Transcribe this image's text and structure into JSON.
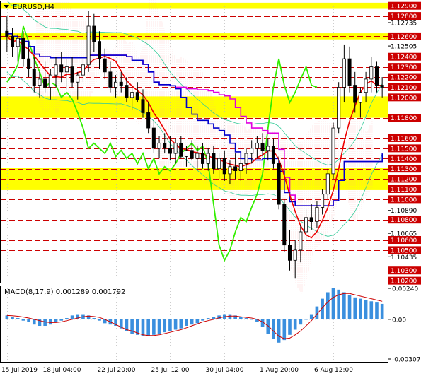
{
  "chart_data": [
    {
      "type": "candlestick",
      "title": "EURUSD,H4",
      "x_ticks": [
        "15 Jul 2019",
        "18 Jul 04:00",
        "22 Jul 20:00",
        "25 Jul 12:00",
        "30 Jul 04:00",
        "1 Aug 20:00",
        "6 Aug 12:00"
      ],
      "ylim": [
        1.1018,
        1.1295
      ],
      "y_ticks": [
        1.129,
        1.128,
        1.12735,
        1.126,
        1.12505,
        1.124,
        1.123,
        1.122,
        1.121,
        1.12,
        1.118,
        1.116,
        1.115,
        1.114,
        1.113,
        1.112,
        1.111,
        1.11,
        1.1089,
        1.108,
        1.10665,
        1.106,
        1.105,
        1.10435,
        1.103,
        1.102
      ],
      "y_tick_labels": [
        "1.12900",
        "1.12800",
        "1.12735",
        "1.12600",
        "1.12505",
        "1.12400",
        "1.12300",
        "1.12200",
        "1.12100",
        "1.12000",
        "1.11800",
        "1.11600",
        "1.11500",
        "1.11400",
        "1.11300",
        "1.11200",
        "1.11100",
        "1.11000",
        "1.10890",
        "1.10800",
        "1.10665",
        "1.10600",
        "1.10500",
        "1.10435",
        "1.10300",
        "1.10200"
      ],
      "highlighted_labels": [
        "1.12900",
        "1.12800",
        "1.12600",
        "1.12400",
        "1.12300",
        "1.12200",
        "1.12100",
        "1.12000",
        "1.11800",
        "1.11600",
        "1.11500",
        "1.11400",
        "1.11300",
        "1.11200",
        "1.11100",
        "1.11000",
        "1.10800",
        "1.10600",
        "1.10500",
        "1.10300",
        "1.10200"
      ],
      "resistance_support_levels": [
        1.129,
        1.128,
        1.126,
        1.124,
        1.123,
        1.122,
        1.121,
        1.12,
        1.118,
        1.116,
        1.115,
        1.114,
        1.113,
        1.112,
        1.111,
        1.11,
        1.108,
        1.106,
        1.105,
        1.103,
        1.102
      ],
      "yellow_zones": [
        [
          1.1287,
          1.1293
        ],
        [
          1.1257,
          1.1263
        ],
        [
          1.118,
          1.1201
        ],
        [
          1.1109,
          1.1131
        ]
      ],
      "candles_ohlc": [
        [
          1.1265,
          1.128,
          1.1245,
          1.126
        ],
        [
          1.126,
          1.1268,
          1.124,
          1.125
        ],
        [
          1.125,
          1.1262,
          1.1235,
          1.1258
        ],
        [
          1.1258,
          1.1265,
          1.123,
          1.1238
        ],
        [
          1.1238,
          1.125,
          1.122,
          1.1228
        ],
        [
          1.1228,
          1.124,
          1.1205,
          1.1212
        ],
        [
          1.1212,
          1.1225,
          1.12,
          1.1218
        ],
        [
          1.1218,
          1.1235,
          1.1205,
          1.121
        ],
        [
          1.121,
          1.1228,
          1.1198,
          1.1222
        ],
        [
          1.1222,
          1.124,
          1.121,
          1.1232
        ],
        [
          1.1232,
          1.1245,
          1.1215,
          1.1225
        ],
        [
          1.1225,
          1.1238,
          1.1208,
          1.123
        ],
        [
          1.123,
          1.124,
          1.121,
          1.1215
        ],
        [
          1.1215,
          1.1225,
          1.1198,
          1.1222
        ],
        [
          1.1222,
          1.1238,
          1.1215,
          1.1232
        ],
        [
          1.1232,
          1.1285,
          1.1225,
          1.127
        ],
        [
          1.127,
          1.1282,
          1.1245,
          1.1255
        ],
        [
          1.1255,
          1.1265,
          1.1228,
          1.1238
        ],
        [
          1.1238,
          1.1248,
          1.1218,
          1.1225
        ],
        [
          1.1225,
          1.1235,
          1.1205,
          1.121
        ],
        [
          1.121,
          1.1222,
          1.12,
          1.1215
        ],
        [
          1.1215,
          1.1225,
          1.1205,
          1.1212
        ],
        [
          1.1212,
          1.122,
          1.1195,
          1.12
        ],
        [
          1.12,
          1.1212,
          1.1188,
          1.1205
        ],
        [
          1.1205,
          1.1215,
          1.1195,
          1.1198
        ],
        [
          1.1198,
          1.1208,
          1.118,
          1.1185
        ],
        [
          1.1185,
          1.1195,
          1.1165,
          1.117
        ],
        [
          1.117,
          1.1178,
          1.1145,
          1.115
        ],
        [
          1.115,
          1.1162,
          1.114,
          1.1155
        ],
        [
          1.1155,
          1.1165,
          1.1145,
          1.115
        ],
        [
          1.115,
          1.1162,
          1.1138,
          1.1145
        ],
        [
          1.1145,
          1.116,
          1.1135,
          1.1155
        ],
        [
          1.1155,
          1.1162,
          1.114,
          1.1142
        ],
        [
          1.1142,
          1.1152,
          1.1132,
          1.1148
        ],
        [
          1.1148,
          1.1158,
          1.1138,
          1.114
        ],
        [
          1.114,
          1.1152,
          1.113,
          1.1145
        ],
        [
          1.1145,
          1.1155,
          1.113,
          1.1135
        ],
        [
          1.1135,
          1.115,
          1.1128,
          1.1145
        ],
        [
          1.1145,
          1.1152,
          1.1125,
          1.113
        ],
        [
          1.113,
          1.1145,
          1.112,
          1.114
        ],
        [
          1.114,
          1.1148,
          1.1118,
          1.1125
        ],
        [
          1.1125,
          1.1138,
          1.1115,
          1.1132
        ],
        [
          1.1132,
          1.1145,
          1.112,
          1.1128
        ],
        [
          1.1128,
          1.114,
          1.1118,
          1.1135
        ],
        [
          1.1135,
          1.115,
          1.1125,
          1.1145
        ],
        [
          1.1145,
          1.1158,
          1.1135,
          1.115
        ],
        [
          1.115,
          1.1162,
          1.114,
          1.1155
        ],
        [
          1.1155,
          1.1165,
          1.1142,
          1.1148
        ],
        [
          1.1148,
          1.116,
          1.1138,
          1.1152
        ],
        [
          1.1152,
          1.116,
          1.113,
          1.1135
        ],
        [
          1.1135,
          1.1142,
          1.109,
          1.1095
        ],
        [
          1.1095,
          1.11,
          1.1048,
          1.1055
        ],
        [
          1.1055,
          1.107,
          1.103,
          1.104
        ],
        [
          1.104,
          1.106,
          1.1022,
          1.105
        ],
        [
          1.105,
          1.1075,
          1.1038,
          1.1068
        ],
        [
          1.1068,
          1.109,
          1.106,
          1.1082
        ],
        [
          1.1082,
          1.1095,
          1.107,
          1.1078
        ],
        [
          1.1078,
          1.1098,
          1.1072,
          1.1092
        ],
        [
          1.1092,
          1.111,
          1.1085,
          1.1105
        ],
        [
          1.1105,
          1.113,
          1.11,
          1.1125
        ],
        [
          1.1125,
          1.1175,
          1.112,
          1.117
        ],
        [
          1.117,
          1.1215,
          1.1165,
          1.121
        ],
        [
          1.121,
          1.1252,
          1.1195,
          1.1238
        ],
        [
          1.1238,
          1.125,
          1.1205,
          1.1212
        ],
        [
          1.1212,
          1.1225,
          1.1185,
          1.1195
        ],
        [
          1.1195,
          1.121,
          1.118,
          1.1205
        ],
        [
          1.1205,
          1.1225,
          1.1195,
          1.1218
        ],
        [
          1.1218,
          1.124,
          1.1205,
          1.123
        ],
        [
          1.123,
          1.1235,
          1.1205,
          1.1212
        ],
        [
          1.1212,
          1.122,
          1.12,
          1.121
        ]
      ],
      "macd": {
        "label": "MACD(8,17,9)",
        "value_a": "0.001289",
        "value_b": "0.001792",
        "ylim": [
          -0.00307,
          0.0024
        ],
        "y_tick_labels": [
          "0.00240",
          "0.00",
          "-0.00307"
        ],
        "y_ticks": [
          0.0024,
          0.0,
          -0.00307
        ],
        "histogram": [
          0.0003,
          0.0002,
          0.0001,
          -0.0001,
          -0.0002,
          -0.0004,
          -0.0005,
          -0.0005,
          -0.0004,
          -0.0002,
          -0.0001,
          0.0001,
          0.0003,
          0.0004,
          0.0004,
          0.0003,
          0.0001,
          -0.0001,
          -0.0003,
          -0.0004,
          -0.0005,
          -0.0007,
          -0.0009,
          -0.0011,
          -0.0012,
          -0.0013,
          -0.0013,
          -0.0012,
          -0.0011,
          -0.001,
          -0.0009,
          -0.0008,
          -0.0007,
          -0.0005,
          -0.0004,
          -0.0003,
          -0.0001,
          0.0001,
          0.0002,
          0.0003,
          0.0004,
          0.0004,
          0.0003,
          0.0002,
          0.0001,
          0.0,
          -0.0002,
          -0.0006,
          -0.0011,
          -0.0015,
          -0.0018,
          -0.0016,
          -0.0012,
          -0.0008,
          -0.0004,
          0.0,
          0.0004,
          0.001,
          0.0016,
          0.0021,
          0.0024,
          0.0023,
          0.0021,
          0.0019,
          0.0017,
          0.0016,
          0.0015,
          0.0014,
          0.0013,
          0.0012
        ],
        "signal": [
          0.0003,
          0.00028,
          0.00024,
          0.00018,
          0.0001,
          0.0,
          -0.0001,
          -0.0002,
          -0.00025,
          -0.00025,
          -0.0002,
          -0.0001,
          0.0,
          0.0001,
          0.0002,
          0.00025,
          0.00022,
          0.00015,
          0.0,
          -0.0002,
          -0.0004,
          -0.0006,
          -0.0008,
          -0.0009,
          -0.00105,
          -0.0012,
          -0.00125,
          -0.00125,
          -0.0012,
          -0.0011,
          -0.001,
          -0.0009,
          -0.0008,
          -0.00065,
          -0.0005,
          -0.00035,
          -0.0002,
          -0.0001,
          0.0,
          0.00012,
          0.0002,
          0.00025,
          0.00025,
          0.0002,
          0.00015,
          0.0001,
          0.0,
          -0.0002,
          -0.0005,
          -0.0009,
          -0.0013,
          -0.0015,
          -0.00145,
          -0.0012,
          -0.0009,
          -0.0005,
          -0.0001,
          0.0004,
          0.0009,
          0.00135,
          0.0017,
          0.0019,
          0.002,
          0.002,
          0.0019,
          0.0018,
          0.0017,
          0.0016,
          0.0015,
          0.0014
        ]
      },
      "colors": {
        "background": "#ffffff",
        "candle": "#000000",
        "grid_dash": "#b8b8b8",
        "level_line": "#cc0000",
        "yellow_zone": "#ffff00",
        "green_line": "#33ee00",
        "red_line": "#ee0000",
        "blue_line": "#0000cc",
        "magenta_line": "#e000e0",
        "cyan_line": "#33cc99",
        "cloud": "#ff9999",
        "macd_hist": "#3a8fde",
        "macd_signal": "#cc0000",
        "label_bg": "#cc0000",
        "label_text": "#ffffff"
      }
    }
  ]
}
